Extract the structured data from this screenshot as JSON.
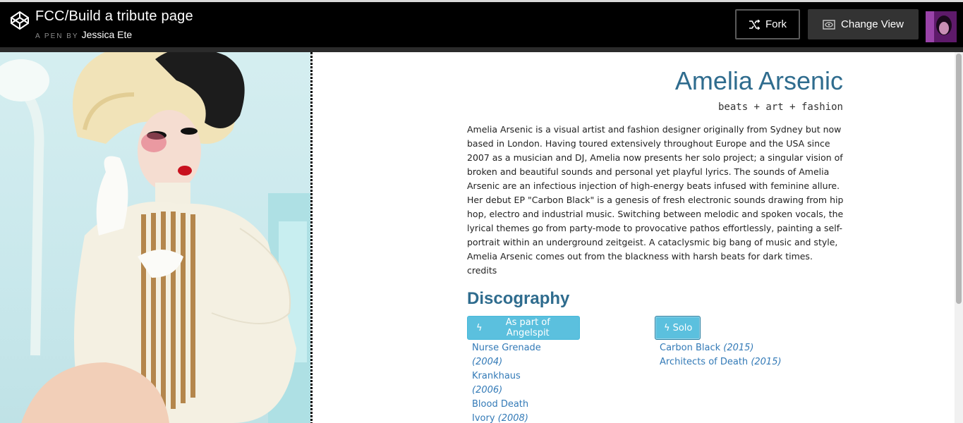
{
  "header": {
    "title": "FCC/Build a tribute page",
    "a_pen_by": "A PEN BY",
    "author": "Jessica Ete",
    "fork_label": "Fork",
    "change_view_label": "Change View"
  },
  "tribute": {
    "name": "Amelia Arsenic",
    "tagline": "beats + art + fashion",
    "bio": "Amelia Arsenic is a visual artist and fashion designer originally from Sydney but now based in London. Having toured extensively throughout Europe and the USA since 2007 as a musician and DJ, Amelia now presents her solo project; a singular vision of broken and beautiful sounds and personal yet playful lyrics. The sounds of Amelia Arsenic are an infectious injection of high-energy beats infused with feminine allure. Her debut EP \"Carbon Black\" is a genesis of fresh electronic sounds drawing from hip hop, electro and industrial music. Switching between melodic and spoken vocals, the lyrical themes go from party-mode to provocative pathos effortlessly, painting a self-portrait within an underground zeitgeist. A cataclysmic big bang of music and style, Amelia Arsenic comes out from the blackness with harsh beats for dark times.",
    "credits_label": "credits"
  },
  "discography": {
    "title": "Discography",
    "group_button": "As part of Angelspit",
    "solo_button": "Solo",
    "group_albums": [
      {
        "title": "Nurse Grenade",
        "year": "(2004)"
      },
      {
        "title": "Krankhaus",
        "year": "(2006)"
      },
      {
        "title": "Blood Death",
        "year": ""
      },
      {
        "title": "Ivory",
        "year": "(2008)"
      }
    ],
    "solo_albums": [
      {
        "title": "Carbon Black",
        "year": "(2015)"
      },
      {
        "title": "Architects of Death",
        "year": "(2015)"
      }
    ]
  },
  "icons": {
    "logo": "codepen-logo-icon",
    "fork": "fork-icon",
    "change_view": "eye-icon",
    "bolt": "bolt-icon"
  },
  "colors": {
    "accent": "#2f6c8e",
    "button": "#5bc0de",
    "link": "#337ab7"
  }
}
